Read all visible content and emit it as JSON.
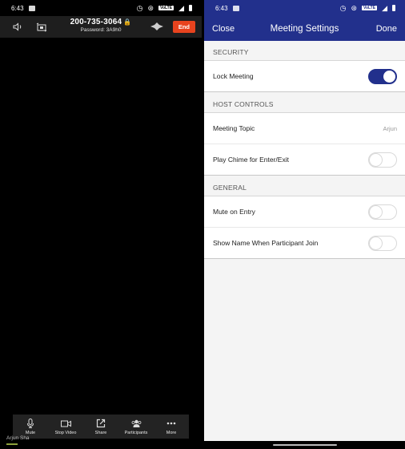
{
  "left": {
    "status_bar": {
      "time": "6:43",
      "volte": "VoLTE"
    },
    "meeting_bar": {
      "meeting_id": "200-735-3064",
      "password": "Password: 3A9h0",
      "end_label": "End",
      "icons": [
        "speaker-icon",
        "switch-camera-icon",
        "audio-wave-icon",
        "lock-icon"
      ]
    },
    "toolbar": {
      "items": [
        {
          "label": "Mute",
          "icon": "microphone-icon"
        },
        {
          "label": "Stop Video",
          "icon": "video-camera-icon"
        },
        {
          "label": "Share",
          "icon": "share-icon"
        },
        {
          "label": "Participants",
          "icon": "participants-icon"
        },
        {
          "label": "More",
          "icon": "more-icon"
        }
      ]
    },
    "name_tag": "Arjun Sha"
  },
  "right": {
    "status_bar": {
      "time": "6:43",
      "volte": "VoLTE"
    },
    "nav": {
      "close_label": "Close",
      "title": "Meeting Settings",
      "done_label": "Done"
    },
    "sections": [
      {
        "header": "SECURITY",
        "rows": [
          {
            "label": "Lock Meeting",
            "type": "toggle",
            "on": true
          }
        ]
      },
      {
        "header": "HOST CONTROLS",
        "rows": [
          {
            "label": "Meeting Topic",
            "type": "value",
            "value": "Arjun"
          },
          {
            "label": "Play Chime for Enter/Exit",
            "type": "toggle",
            "on": false
          }
        ]
      },
      {
        "header": "GENERAL",
        "rows": [
          {
            "label": "Mute on Entry",
            "type": "toggle",
            "on": false
          },
          {
            "label": "Show Name When Participant Join",
            "type": "toggle",
            "on": false
          }
        ]
      }
    ]
  },
  "colors": {
    "brand_blue": "#22308c",
    "end_red": "#e8431e"
  }
}
